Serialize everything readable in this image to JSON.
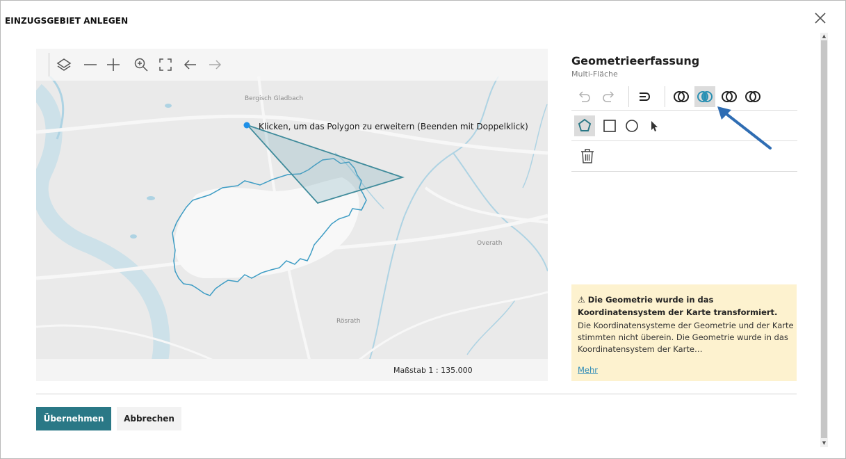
{
  "dialog": {
    "title": "EINZUGSGEBIET ANLEGEN",
    "close_icon": "close-icon"
  },
  "map": {
    "toolbar": {
      "icons": [
        "layers-icon",
        "zoom-out-icon",
        "zoom-in-icon",
        "zoom-area-icon",
        "fullscreen-icon",
        "back-arrow-icon",
        "forward-arrow-icon"
      ]
    },
    "place_labels": {
      "bergisch": "Bergisch Gladbach",
      "overath": "Overath",
      "rosrath": "Rösrath"
    },
    "hint": "Klicken, um das Polygon zu erweitern (Beenden mit Doppelklick)",
    "scale": "Maßstab 1 : 135.000",
    "colors": {
      "polygon": "#2f8aa5",
      "sketch": "#3f8b9b",
      "vertex": "#1e90e8",
      "water": "#aed3e3"
    }
  },
  "panel": {
    "title": "Geometrieerfassung",
    "subtitle": "Multi-Fläche",
    "edit_icons": [
      "undo-icon",
      "redo-icon",
      "reshape-icon",
      "union-icon",
      "intersect-icon",
      "difference-icon",
      "exclusive-icon"
    ],
    "shape_icons": [
      "polygon-icon",
      "rectangle-icon",
      "circle-icon",
      "select-pointer-icon"
    ],
    "delete_icon": "trash-icon",
    "active_boolean_tool": "intersect-icon",
    "active_shape_tool": "polygon-icon"
  },
  "warning": {
    "icon": "warning-icon",
    "title": "Die Geometrie wurde in das Koordinatensystem der Karte transformiert.",
    "body": "Die Koordinatensysteme der Geometrie und der Karte stimmten nicht überein. Die Geometrie wurde in das Koordinatensystem der Karte…",
    "link": "Mehr",
    "background": "#fdf2cf"
  },
  "footer": {
    "apply": "Übernehmen",
    "cancel": "Abbrechen",
    "accent": "#2a7886"
  },
  "annotation": {
    "arrow_color": "#2f6db3"
  }
}
